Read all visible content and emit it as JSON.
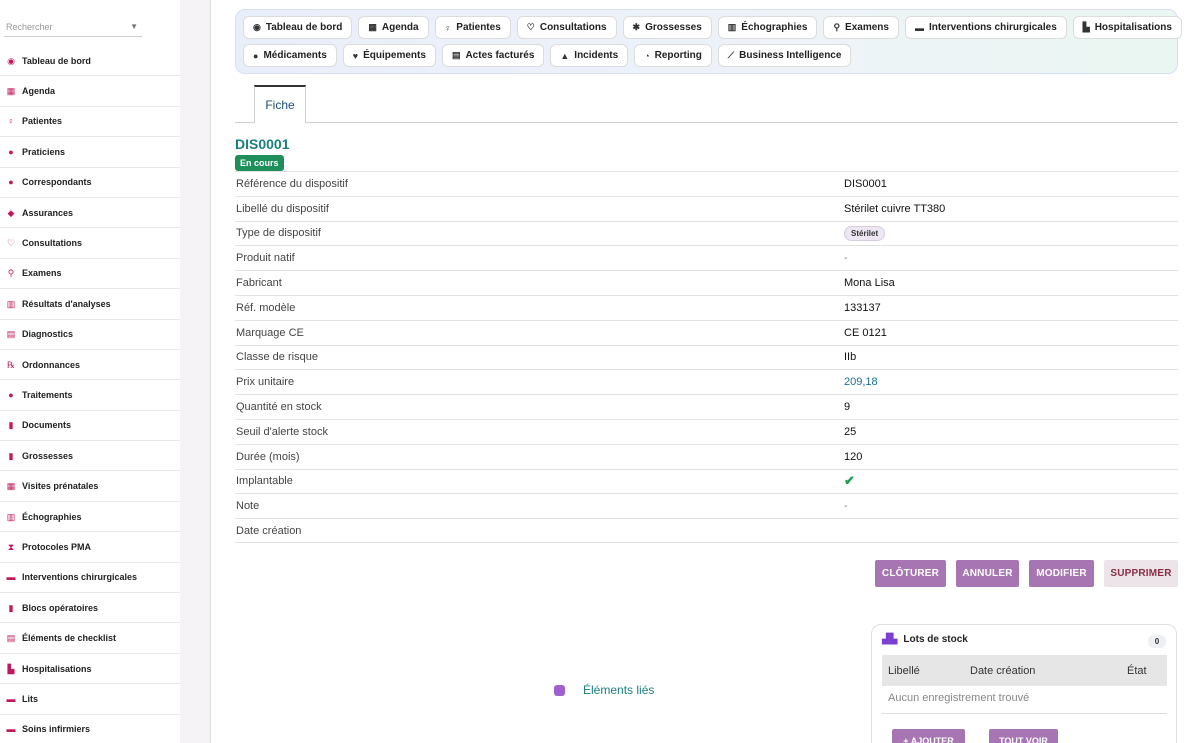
{
  "sidebar": {
    "search_placeholder": "Rechercher",
    "items": [
      {
        "label": "Tableau de bord",
        "icon": "dashboard-icon",
        "glyph": "◉"
      },
      {
        "label": "Agenda",
        "icon": "calendar-icon",
        "glyph": "▦"
      },
      {
        "label": "Patientes",
        "icon": "female-icon",
        "glyph": "♀"
      },
      {
        "label": "Praticiens",
        "icon": "user-doctor-icon",
        "glyph": "●"
      },
      {
        "label": "Correspondants",
        "icon": "user-icon",
        "glyph": "●"
      },
      {
        "label": "Assurances",
        "icon": "shield-icon",
        "glyph": "◆"
      },
      {
        "label": "Consultations",
        "icon": "stethoscope-icon",
        "glyph": "♡"
      },
      {
        "label": "Examens",
        "icon": "microscope-icon",
        "glyph": "⚲"
      },
      {
        "label": "Résultats d'analyses",
        "icon": "vials-icon",
        "glyph": "▥"
      },
      {
        "label": "Diagnostics",
        "icon": "clipboard-icon",
        "glyph": "▤"
      },
      {
        "label": "Ordonnances",
        "icon": "prescription-icon",
        "glyph": "℞"
      },
      {
        "label": "Traitements",
        "icon": "pills-icon",
        "glyph": "●"
      },
      {
        "label": "Documents",
        "icon": "file-icon",
        "glyph": "▮"
      },
      {
        "label": "Grossesses",
        "icon": "baby-icon",
        "glyph": "▮"
      },
      {
        "label": "Visites prénatales",
        "icon": "calendar-check-icon",
        "glyph": "▦"
      },
      {
        "label": "Échographies",
        "icon": "ultrasound-icon",
        "glyph": "▥"
      },
      {
        "label": "Protocoles PMA",
        "icon": "hourglass-icon",
        "glyph": "⧗"
      },
      {
        "label": "Interventions chirurgicales",
        "icon": "surgery-bed-icon",
        "glyph": "▬"
      },
      {
        "label": "Blocs opératoires",
        "icon": "hospital-icon",
        "glyph": "▮"
      },
      {
        "label": "Éléments de checklist",
        "icon": "checklist-icon",
        "glyph": "▤"
      },
      {
        "label": "Hospitalisations",
        "icon": "hospital-user-icon",
        "glyph": "▙"
      },
      {
        "label": "Lits",
        "icon": "bed-icon",
        "glyph": "▬"
      },
      {
        "label": "Soins infirmiers",
        "icon": "nurse-icon",
        "glyph": "▬"
      }
    ]
  },
  "topnav": {
    "row1": [
      {
        "label": "Tableau de bord",
        "icon": "dashboard-icon",
        "glyph": "◉"
      },
      {
        "label": "Agenda",
        "icon": "calendar-icon",
        "glyph": "▦"
      },
      {
        "label": "Patientes",
        "icon": "female-icon",
        "glyph": "♀"
      },
      {
        "label": "Consultations",
        "icon": "stethoscope-icon",
        "glyph": "♡"
      },
      {
        "label": "Grossesses",
        "icon": "baby-icon",
        "glyph": "✱"
      },
      {
        "label": "Échographies",
        "icon": "ultrasound-icon",
        "glyph": "▥"
      },
      {
        "label": "Examens",
        "icon": "microscope-icon",
        "glyph": "⚲"
      },
      {
        "label": "Interventions chirurgicales",
        "icon": "surgery-bed-icon",
        "glyph": "▬"
      },
      {
        "label": "Hospitalisations",
        "icon": "hospital-user-icon",
        "glyph": "▙"
      }
    ],
    "row2": [
      {
        "label": "Médicaments",
        "icon": "pills-icon",
        "glyph": "●"
      },
      {
        "label": "Équipements",
        "icon": "heart-pulse-icon",
        "glyph": "♥"
      },
      {
        "label": "Actes facturés",
        "icon": "invoice-icon",
        "glyph": "▤"
      },
      {
        "label": "Incidents",
        "icon": "warning-icon",
        "glyph": "▲"
      },
      {
        "label": "Reporting",
        "icon": "pie-chart-icon",
        "glyph": "◔"
      },
      {
        "label": "Business Intelligence",
        "icon": "line-chart-icon",
        "glyph": "⟋"
      }
    ]
  },
  "tabs": {
    "fiche": "Fiche"
  },
  "record": {
    "title": "DIS0001",
    "status": "En cours",
    "fields": [
      {
        "key": "Référence du dispositif",
        "value": "DIS0001",
        "kind": "text"
      },
      {
        "key": "Libellé du dispositif",
        "value": "Stérilet cuivre TT380",
        "kind": "text"
      },
      {
        "key": "Type de dispositif",
        "value": "Stérilet",
        "kind": "chip"
      },
      {
        "key": "Produit natif",
        "value": "-",
        "kind": "dash"
      },
      {
        "key": "Fabricant",
        "value": "Mona Lisa",
        "kind": "text"
      },
      {
        "key": "Réf. modèle",
        "value": "133137",
        "kind": "text"
      },
      {
        "key": "Marquage CE",
        "value": "CE 0121",
        "kind": "text"
      },
      {
        "key": "Classe de risque",
        "value": "IIb",
        "kind": "text"
      },
      {
        "key": "Prix unitaire",
        "value": "209,18",
        "kind": "price"
      },
      {
        "key": "Quantité en stock",
        "value": "9",
        "kind": "text"
      },
      {
        "key": "Seuil d'alerte stock",
        "value": "25",
        "kind": "text"
      },
      {
        "key": "Durée (mois)",
        "value": "120",
        "kind": "text"
      },
      {
        "key": "Implantable",
        "value": "✔",
        "kind": "check"
      },
      {
        "key": "Note",
        "value": "-",
        "kind": "dash"
      },
      {
        "key": "Date création",
        "value": "",
        "kind": "text"
      }
    ]
  },
  "actions": {
    "close": "CLÔTURER",
    "cancel": "ANNULER",
    "edit": "MODIFIER",
    "delete": "SUPPRIMER"
  },
  "linked": {
    "label": "Éléments liés"
  },
  "stock_panel": {
    "title": "Lots de stock",
    "count": "0",
    "columns": [
      "Libellé",
      "Date création",
      "État"
    ],
    "empty": "Aucun enregistrement trouvé",
    "add": "+ AJOUTER",
    "view_all": "TOUT VOIR"
  }
}
